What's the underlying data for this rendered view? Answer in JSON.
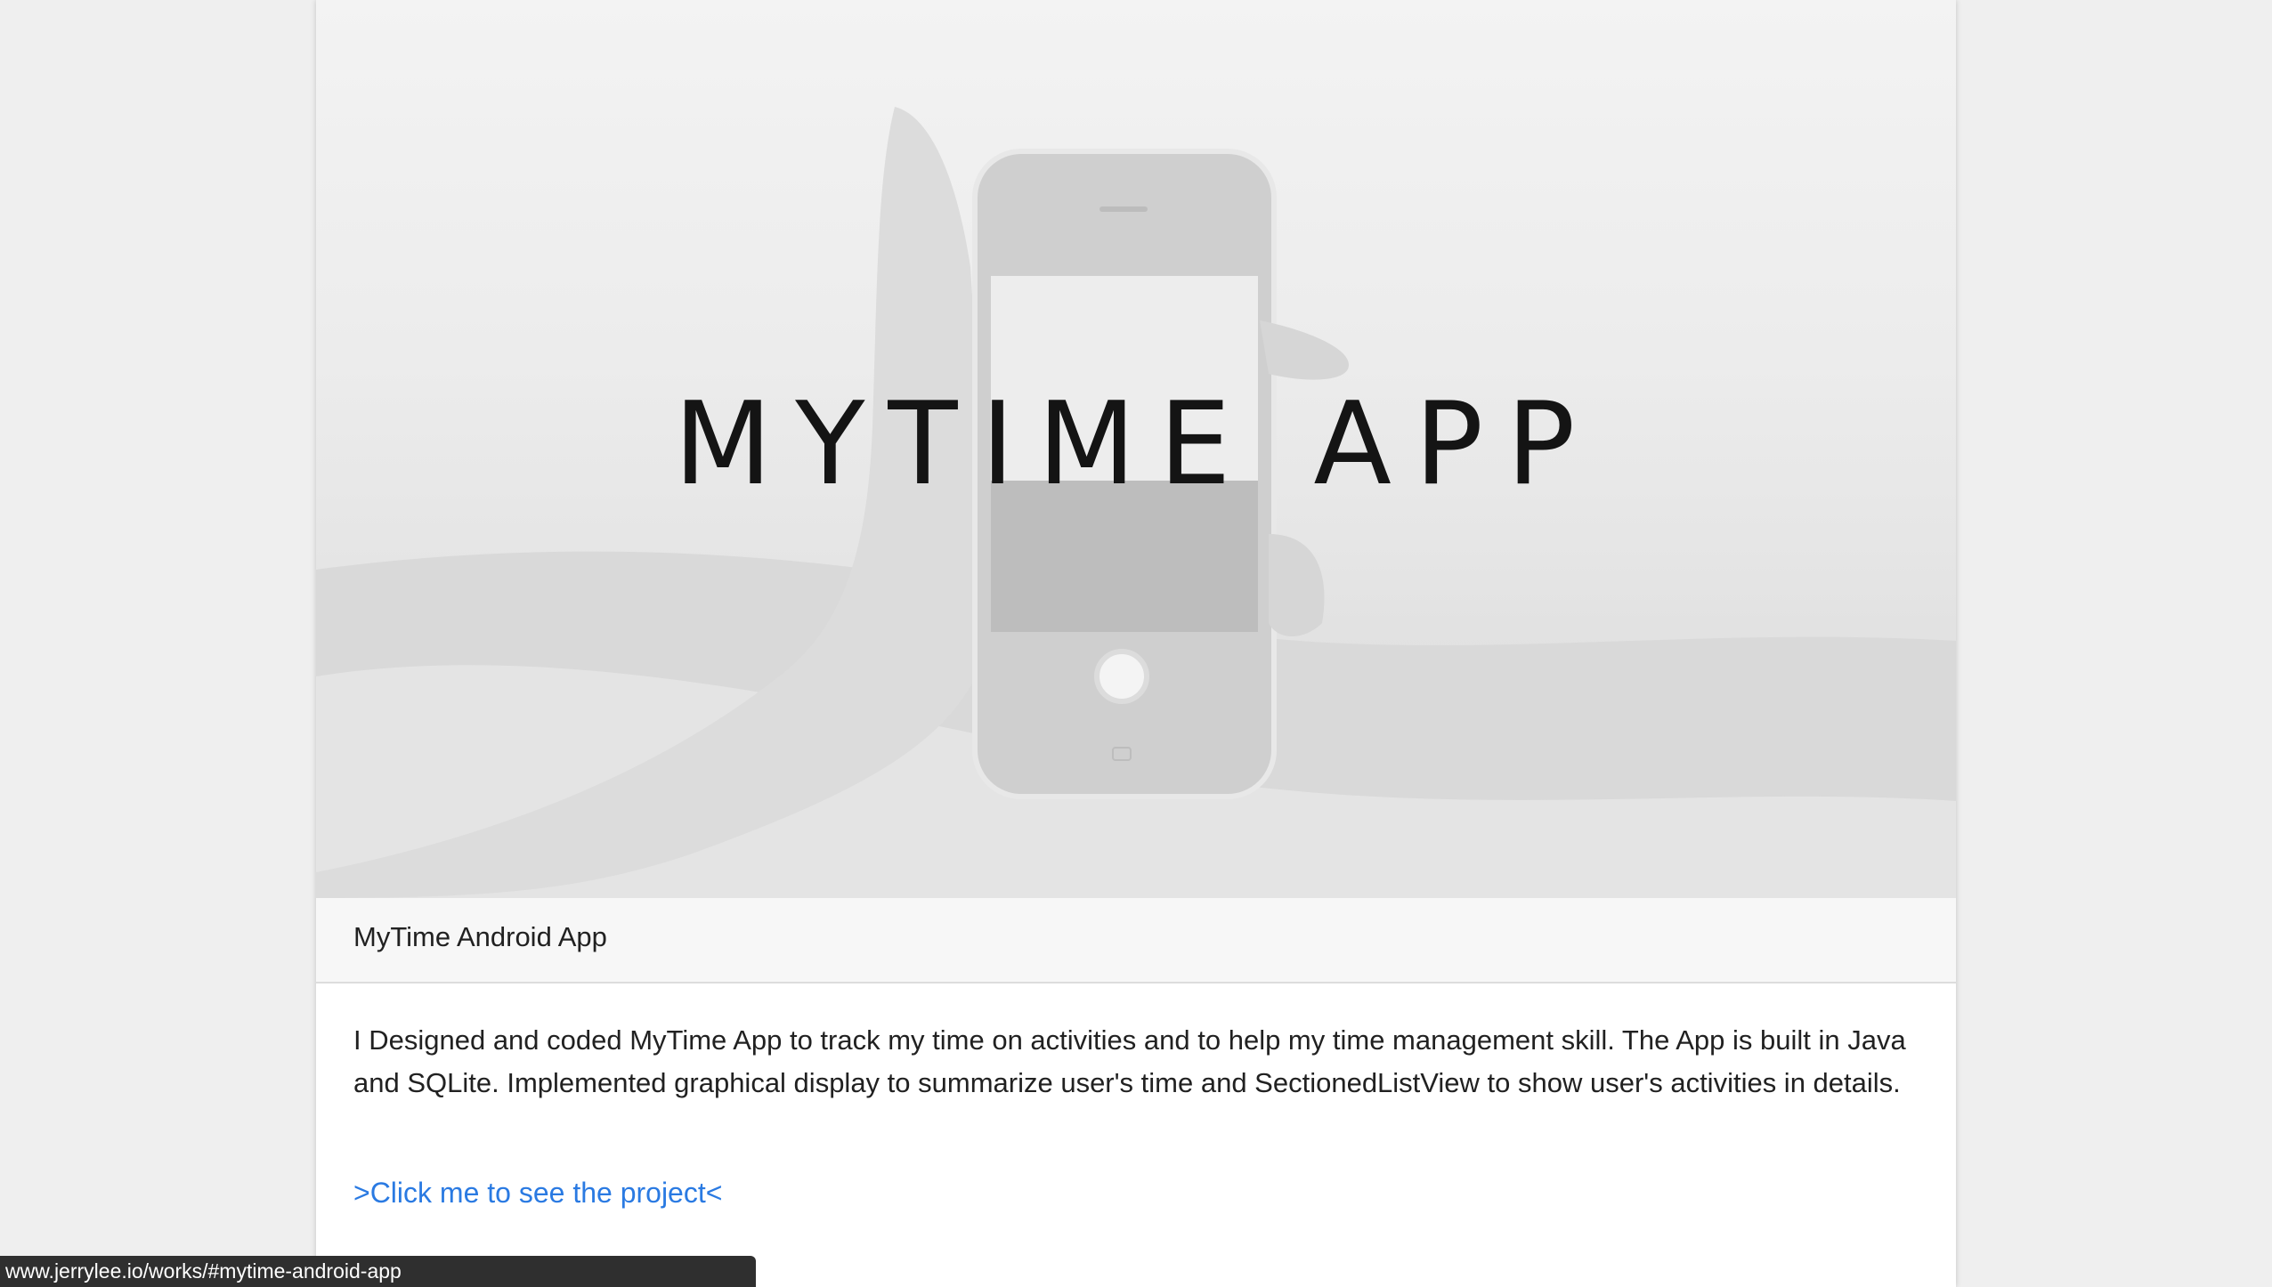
{
  "hero": {
    "title": "MYTIME APP",
    "image_description_icon": "phone-in-hand-image"
  },
  "card": {
    "header_title": "MyTime Android App",
    "description": "I Designed and coded MyTime App to track my time on activities and to help my time management skill. The App is built in Java and SQLite. Implemented graphical display to summarize user's time and SectionedListView to show user's activities in details.",
    "link_text": ">Click me to see the project<"
  },
  "status_bar": {
    "url": "www.jerrylee.io/works/#mytime-android-app"
  },
  "colors": {
    "page_bg": "#efefef",
    "link": "#2a7ae2",
    "status_bar_bg": "#2f2f2f",
    "header_bg": "#f7f7f7"
  }
}
